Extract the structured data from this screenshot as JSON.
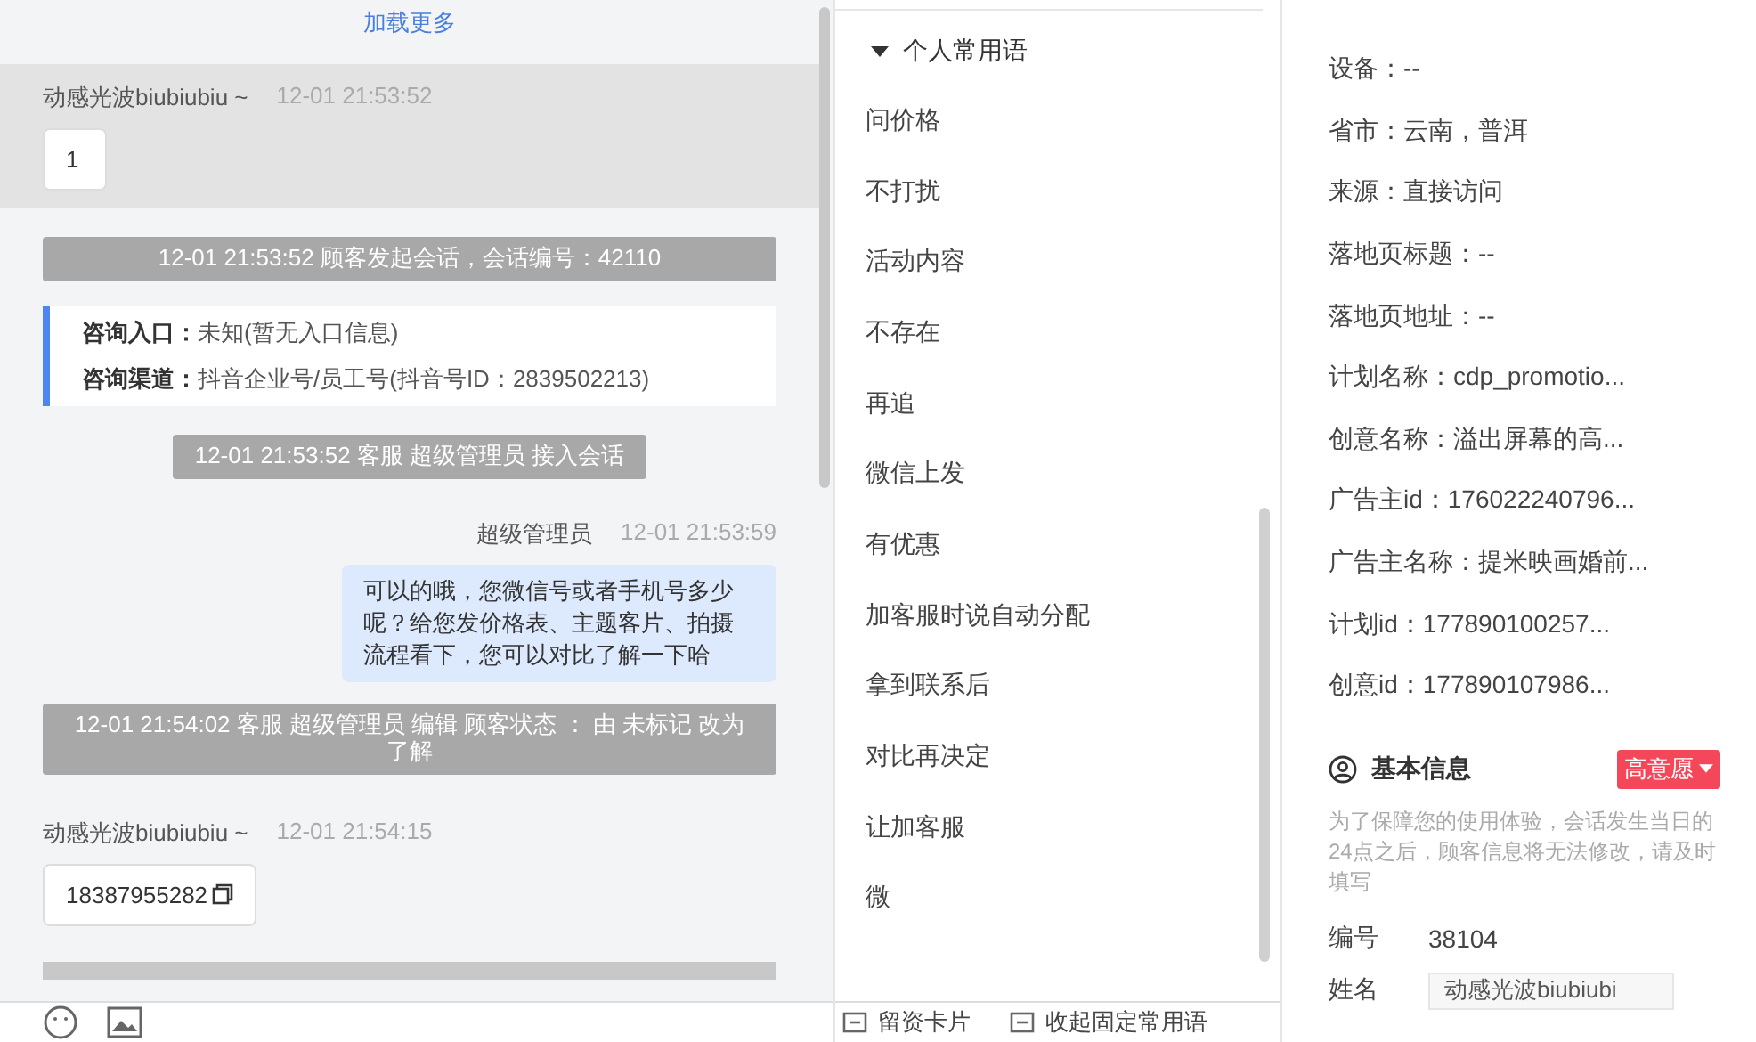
{
  "chat": {
    "load_more": "加载更多",
    "messages": [
      {
        "kind": "customer",
        "highlighted": true,
        "sender": "动感光波biubiubiu ~",
        "time": "12-01 21:53:52",
        "text": "1",
        "copyable": false
      },
      {
        "kind": "system",
        "text": "12-01 21:53:52 顾客发起会话，会话编号：42110"
      },
      {
        "kind": "info",
        "lines": [
          {
            "label": "咨询入口：",
            "value": "未知(暂无入口信息)"
          },
          {
            "label": "咨询渠道：",
            "value": "抖音企业号/员工号(抖音号ID：2839502213)"
          }
        ]
      },
      {
        "kind": "system",
        "text": "12-01 21:53:52 客服 超级管理员 接入会话"
      },
      {
        "kind": "agent",
        "sender": "超级管理员",
        "time": "12-01 21:53:59",
        "text": "可以的哦，您微信号或者手机号多少呢？给您发价格表、主题客片、拍摄流程看下，您可以对比了解一下哈"
      },
      {
        "kind": "system",
        "text": "12-01 21:54:02 客服 超级管理员 编辑 顾客状态 ： 由 未标记 改为了解"
      },
      {
        "kind": "customer",
        "highlighted": false,
        "sender": "动感光波biubiubiu ~",
        "time": "12-01 21:54:15",
        "text": "18387955282",
        "copyable": true
      },
      {
        "kind": "system_cut"
      }
    ],
    "toolbar": [
      {
        "kind": "emoji"
      },
      {
        "kind": "image"
      }
    ]
  },
  "quick_replies": {
    "group": "个人常用语",
    "expanded": true,
    "items": [
      "问价格",
      "不打扰",
      "活动内容",
      "不存在",
      "再追",
      "微信上发",
      "有优惠",
      "加客服时说自动分配",
      "拿到联系后",
      "对比再决定",
      "让加客服",
      "微"
    ],
    "footer": [
      "留资卡片",
      "收起固定常用语"
    ]
  },
  "visit_info": [
    "设备：--",
    "省市：云南，普洱",
    "来源：直接访问",
    "落地页标题：--",
    "落地页地址：--",
    "计划名称：cdp_promotio...",
    "创意名称：溢出屏幕的高...",
    "广告主id：176022240796...",
    "广告主名称：提米映画婚前...",
    "计划id：177890100257...",
    "创意id：177890107986..."
  ],
  "basic_info": {
    "title": "基本信息",
    "intent": "高意愿",
    "note": "为了保障您的使用体验，会话发生当日的24点之后，顾客信息将无法修改，请及时填写",
    "fields": [
      {
        "kind": "text",
        "label": "编号",
        "value": "38104"
      },
      {
        "kind": "input",
        "label": "姓名",
        "value": "动感光波biubiubi"
      }
    ]
  }
}
